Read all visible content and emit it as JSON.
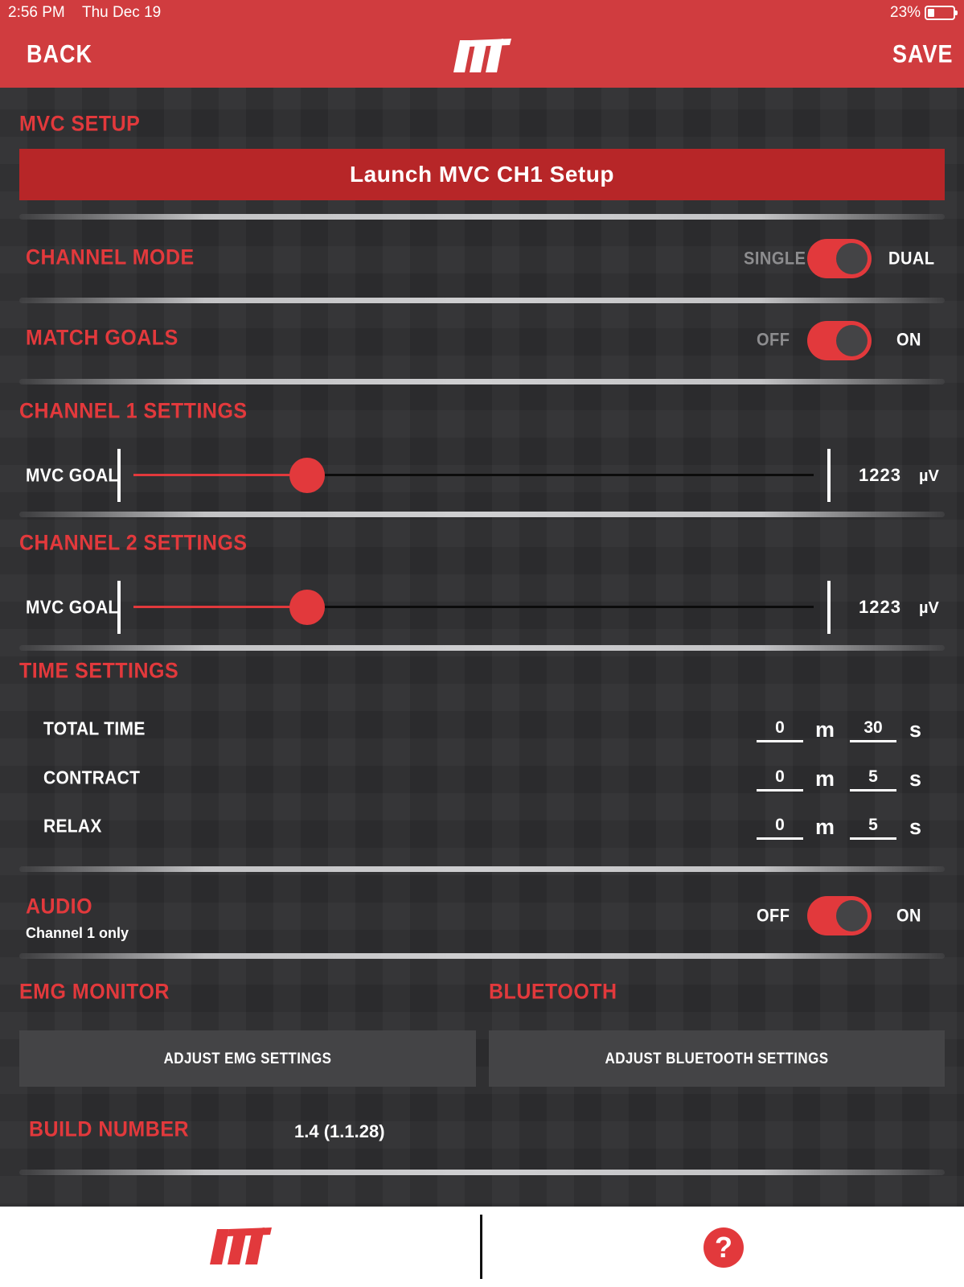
{
  "status_bar": {
    "time": "2:56 PM",
    "date": "Thu Dec 19",
    "battery": "23%"
  },
  "header": {
    "back_label": "BACK",
    "save_label": "SAVE",
    "logo_icon": "brand-logo-icon"
  },
  "mvc_setup": {
    "title": "MVC SETUP",
    "launch_label": "Launch MVC CH1 Setup"
  },
  "channel_mode": {
    "title": "CHANNEL MODE",
    "off_label": "SINGLE",
    "on_label": "DUAL",
    "state": "on"
  },
  "match_goals": {
    "title": "MATCH GOALS",
    "off_label": "OFF",
    "on_label": "ON",
    "state": "on"
  },
  "channel1": {
    "title": "CHANNEL 1 SETTINGS",
    "goal_label": "MVC GOAL",
    "value": "1223",
    "unit": "µV",
    "slider_fraction": 0.255
  },
  "channel2": {
    "title": "CHANNEL 2 SETTINGS",
    "goal_label": "MVC GOAL",
    "value": "1223",
    "unit": "µV",
    "slider_fraction": 0.255
  },
  "time_settings": {
    "title": "TIME SETTINGS",
    "minutes_unit": "m",
    "seconds_unit": "s",
    "rows": [
      {
        "label": "TOTAL TIME",
        "minutes": "0",
        "seconds": "30"
      },
      {
        "label": "CONTRACT",
        "minutes": "0",
        "seconds": "5"
      },
      {
        "label": "RELAX",
        "minutes": "0",
        "seconds": "5"
      }
    ]
  },
  "audio": {
    "title": "AUDIO",
    "subtitle": "Channel 1 only",
    "off_label": "OFF",
    "on_label": "ON",
    "state": "on"
  },
  "emg_monitor": {
    "title": "EMG MONITOR",
    "button_label": "ADJUST EMG SETTINGS"
  },
  "bluetooth": {
    "title": "BLUETOOTH",
    "button_label": "ADJUST BLUETOOTH SETTINGS"
  },
  "build": {
    "label": "BUILD NUMBER",
    "value": "1.4 (1.1.28)"
  },
  "tab_bar": {
    "home_icon": "brand-logo-icon",
    "help_glyph": "?",
    "accent_color": "#e2393c"
  },
  "colors": {
    "header_red": "#d03c3f",
    "accent_red": "#e2393c",
    "launch_red": "#b72628",
    "background": "#2b2b2d",
    "button_grey": "#444446"
  }
}
